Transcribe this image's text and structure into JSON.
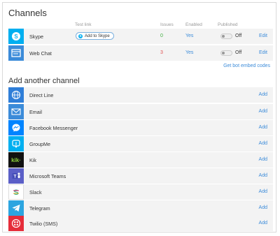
{
  "header": {
    "title": "Channels",
    "columns": {
      "test_link": "Test link",
      "issues": "Issues",
      "enabled": "Enabled",
      "published": "Published"
    }
  },
  "connected": [
    {
      "name": "Skype",
      "icon": "skype-icon",
      "test_link_label": "Add to Skype",
      "issues": "0",
      "issues_color": "#3cae3c",
      "enabled": "Yes",
      "published": "Off",
      "edit": "Edit"
    },
    {
      "name": "Web Chat",
      "icon": "web-chat-icon",
      "test_link_label": "",
      "issues": "3",
      "issues_color": "#e05050",
      "enabled": "Yes",
      "published": "Off",
      "edit": "Edit"
    }
  ],
  "embed_link": "Get bot embed codes",
  "add_section": {
    "title": "Add another channel",
    "add_label": "Add",
    "channels": [
      {
        "name": "Direct Line",
        "icon": "globe-icon",
        "color": "#2f7ed8"
      },
      {
        "name": "Email",
        "icon": "email-icon",
        "color": "#3b8bd9"
      },
      {
        "name": "Facebook Messenger",
        "icon": "messenger-icon",
        "color": "#0084ff"
      },
      {
        "name": "GroupMe",
        "icon": "groupme-icon",
        "color": "#00aff0"
      },
      {
        "name": "Kik",
        "icon": "kik-icon",
        "color": "#111111"
      },
      {
        "name": "Microsoft Teams",
        "icon": "teams-icon",
        "color": "#5b5fc7"
      },
      {
        "name": "Slack",
        "icon": "slack-icon",
        "color": "#ffffff"
      },
      {
        "name": "Telegram",
        "icon": "telegram-icon",
        "color": "#2ca5e0"
      },
      {
        "name": "Twilio (SMS)",
        "icon": "twilio-icon",
        "color": "#e52d3a"
      }
    ]
  }
}
